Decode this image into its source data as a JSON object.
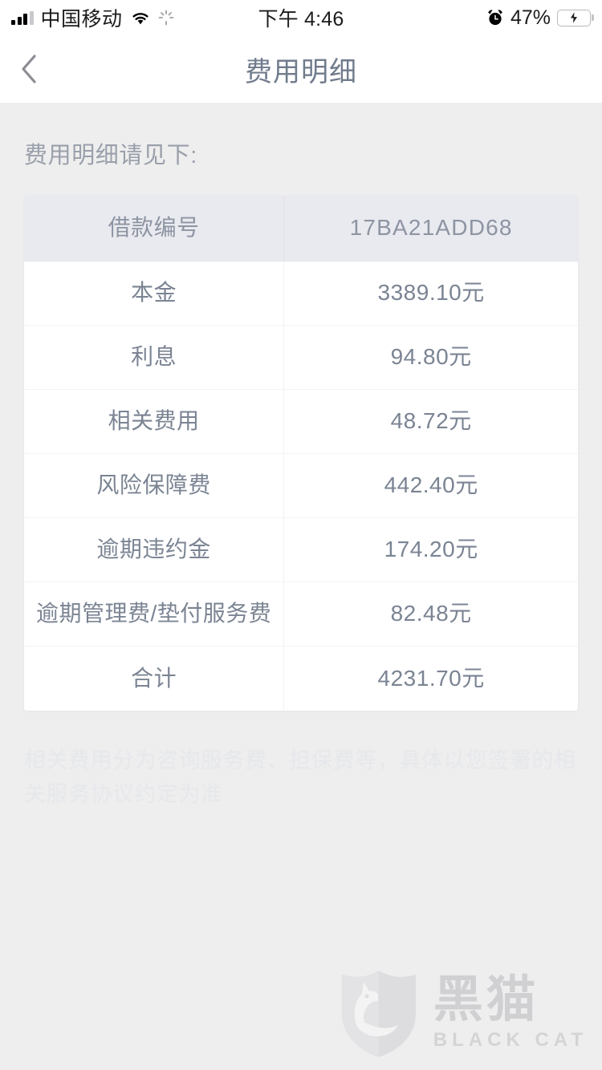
{
  "status_bar": {
    "carrier": "中国移动",
    "time": "下午 4:46",
    "battery_percent": "47%",
    "battery_level": 47,
    "icons": [
      "signal-bars-icon",
      "wifi-icon",
      "activity-spinner-icon",
      "alarm-clock-icon",
      "battery-charging-icon"
    ]
  },
  "nav": {
    "title": "费用明细",
    "back_icon": "chevron-left-icon"
  },
  "main": {
    "subtitle": "费用明细请见下:",
    "table": {
      "header": {
        "label": "借款编号",
        "value": "17BA21ADD68"
      },
      "rows": [
        {
          "label": "本金",
          "value": "3389.10元"
        },
        {
          "label": "利息",
          "value": "94.80元"
        },
        {
          "label": "相关费用",
          "value": "48.72元"
        },
        {
          "label": "风险保障费",
          "value": "442.40元"
        },
        {
          "label": "逾期违约金",
          "value": "174.20元"
        },
        {
          "label": "逾期管理费/垫付服务费",
          "value": "82.48元"
        },
        {
          "label": "合计",
          "value": "4231.70元"
        }
      ]
    },
    "footnote": "相关费用分为咨询服务费、担保费等，具体以您签署的相关服务协议约定为准"
  },
  "watermark": {
    "cn": "黑猫",
    "en": "BLACK CAT",
    "icon": "cat-shield-logo-icon"
  },
  "colors": {
    "page_background": "#eeeeee",
    "card_background": "#ffffff",
    "table_header_background": "#e9eaef",
    "text_primary": "#7b8493",
    "title": "#707b8c",
    "subtitle": "#9aa0ab",
    "battery_green": "#5ee882"
  }
}
